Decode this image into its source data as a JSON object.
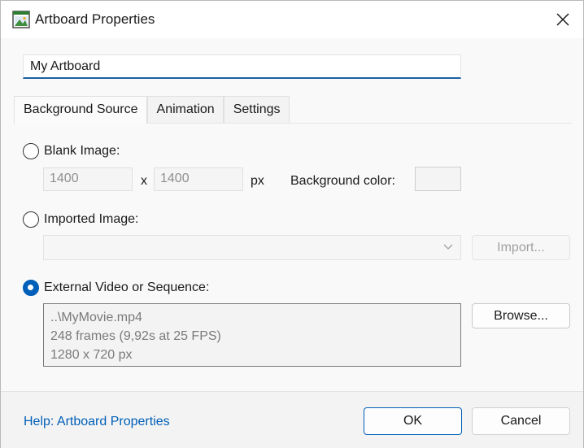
{
  "window": {
    "title": "Artboard Properties"
  },
  "name_field": {
    "value": "My Artboard"
  },
  "tabs": [
    {
      "label": "Background Source",
      "active": true
    },
    {
      "label": "Animation",
      "active": false
    },
    {
      "label": "Settings",
      "active": false
    }
  ],
  "background_source": {
    "blank_image": {
      "label": "Blank Image:",
      "selected": false,
      "width": "1400",
      "x_sep": "x",
      "height": "1400",
      "unit": "px",
      "bg_color_label": "Background color:"
    },
    "imported_image": {
      "label": "Imported Image:",
      "selected": false,
      "dropdown_value": "",
      "import_button": "Import..."
    },
    "external_video": {
      "label": "External Video or Sequence:",
      "selected": true,
      "info_lines": [
        "..\\MyMovie.mp4",
        "248 frames (9,92s at 25 FPS)",
        "1280 x 720 px"
      ],
      "browse_button": "Browse..."
    }
  },
  "footer": {
    "help_link": "Help: Artboard Properties",
    "ok_button": "OK",
    "cancel_button": "Cancel"
  },
  "colors": {
    "accent": "#005fb8",
    "background": "#f9f9f9",
    "disabled_text": "#8f8f8f"
  }
}
